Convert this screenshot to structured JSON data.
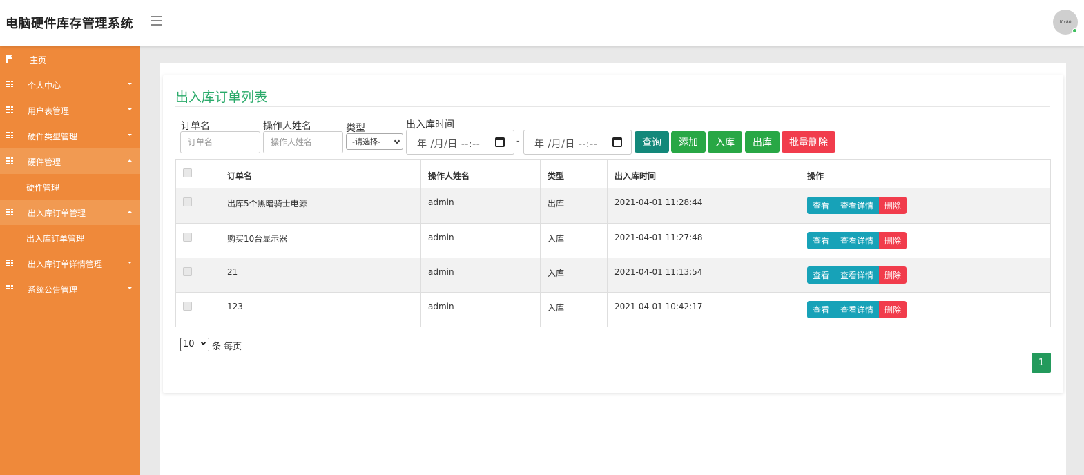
{
  "header": {
    "app_title": "电脑硬件库存管理系统",
    "avatar_text": "f0x80"
  },
  "sidebar": {
    "items": [
      {
        "label": "主页",
        "icon": "flag-icon",
        "expanded": null
      },
      {
        "label": "个人中心",
        "icon": "grid-icon",
        "expanded": false
      },
      {
        "label": "用户表管理",
        "icon": "grid-icon",
        "expanded": false
      },
      {
        "label": "硬件类型管理",
        "icon": "grid-icon",
        "expanded": false
      },
      {
        "label": "硬件管理",
        "icon": "grid-icon",
        "expanded": true
      },
      {
        "label": "硬件管理",
        "icon": null,
        "sub": true
      },
      {
        "label": "出入库订单管理",
        "icon": "grid-icon",
        "expanded": true
      },
      {
        "label": "出入库订单管理",
        "icon": null,
        "sub": true
      },
      {
        "label": "出入库订单详情管理",
        "icon": "grid-icon",
        "expanded": false
      },
      {
        "label": "系统公告管理",
        "icon": "grid-icon",
        "expanded": false
      }
    ]
  },
  "page": {
    "title": "出入库订单列表"
  },
  "filters": {
    "order_name_label": "订单名",
    "order_name_placeholder": "订单名",
    "operator_label": "操作人姓名",
    "operator_placeholder": "操作人姓名",
    "type_label": "类型",
    "type_selected": "-请选择-",
    "time_label": "出入库时间",
    "date_start": "年 /月/日 --:--",
    "date_end": "年 /月/日 --:--",
    "date_sep": "-"
  },
  "toolbar": {
    "query": "查询",
    "add": "添加",
    "stock_in": "入库",
    "stock_out": "出库",
    "batch_delete": "批量删除"
  },
  "table": {
    "headers": [
      "订单名",
      "操作人姓名",
      "类型",
      "出入库时间",
      "操作"
    ],
    "rows": [
      {
        "name": "出库5个黑暗骑士电源",
        "operator": "admin",
        "type": "出库",
        "time": "2021-04-01 11:28:44"
      },
      {
        "name": "购买10台显示器",
        "operator": "admin",
        "type": "入库",
        "time": "2021-04-01 11:27:48"
      },
      {
        "name": "21",
        "operator": "admin",
        "type": "入库",
        "time": "2021-04-01 11:13:54"
      },
      {
        "name": "123",
        "operator": "admin",
        "type": "入库",
        "time": "2021-04-01 10:42:17"
      }
    ],
    "actions": {
      "view": "查看",
      "detail": "查看详情",
      "delete": "删除"
    }
  },
  "pagination": {
    "page_size": "10",
    "per_page_label": "条 每页",
    "current_page": "1"
  },
  "colors": {
    "sidebar": "#ef893a",
    "title_green": "#2aaa6a",
    "btn_green": "#28a745",
    "btn_red": "#f13c4c",
    "btn_info": "#17a2b8"
  }
}
